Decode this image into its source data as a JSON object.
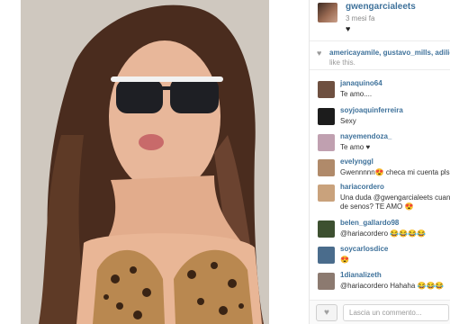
{
  "post": {
    "author": "gwengarcialeets",
    "time": "3 mesi fa",
    "like_mark": "♥"
  },
  "likes": {
    "names": "americayamile, gustavo_mills, adilio",
    "suffix": "like this."
  },
  "comments": [
    {
      "user": "janaquino64",
      "text": "Te amo....",
      "avatar_color": "#6e5040"
    },
    {
      "user": "soyjoaquinferreira",
      "text": "Sexy",
      "avatar_color": "#1c1c1c"
    },
    {
      "user": "nayemendoza_",
      "text": "Te amo ♥",
      "avatar_color": "#c0a0b0"
    },
    {
      "user": "evelynggl",
      "text": "Gwennnnn😍 checa mi cuenta pls😍",
      "avatar_color": "#b08a6a"
    },
    {
      "user": "hariacordero",
      "text": "Una duda @gwengarcialeets cuanto",
      "text2": "de senos? TE AMO 😍",
      "avatar_color": "#c9a27c"
    },
    {
      "user": "belen_gallardo98",
      "text": "@hariacordero 😂😂😂😂",
      "avatar_color": "#3d5030"
    },
    {
      "user": "soycarlosdice",
      "text": "😍",
      "avatar_color": "#4a6c8c"
    },
    {
      "user": "1dianalizeth",
      "text": "@hariacordero Hahaha 😂😂😂",
      "avatar_color": "#8c7a70"
    }
  ],
  "composer": {
    "placeholder": "Lascia un commento...",
    "like_icon": "heart-icon"
  },
  "colors": {
    "link": "#3f729b",
    "border": "#ececec"
  }
}
